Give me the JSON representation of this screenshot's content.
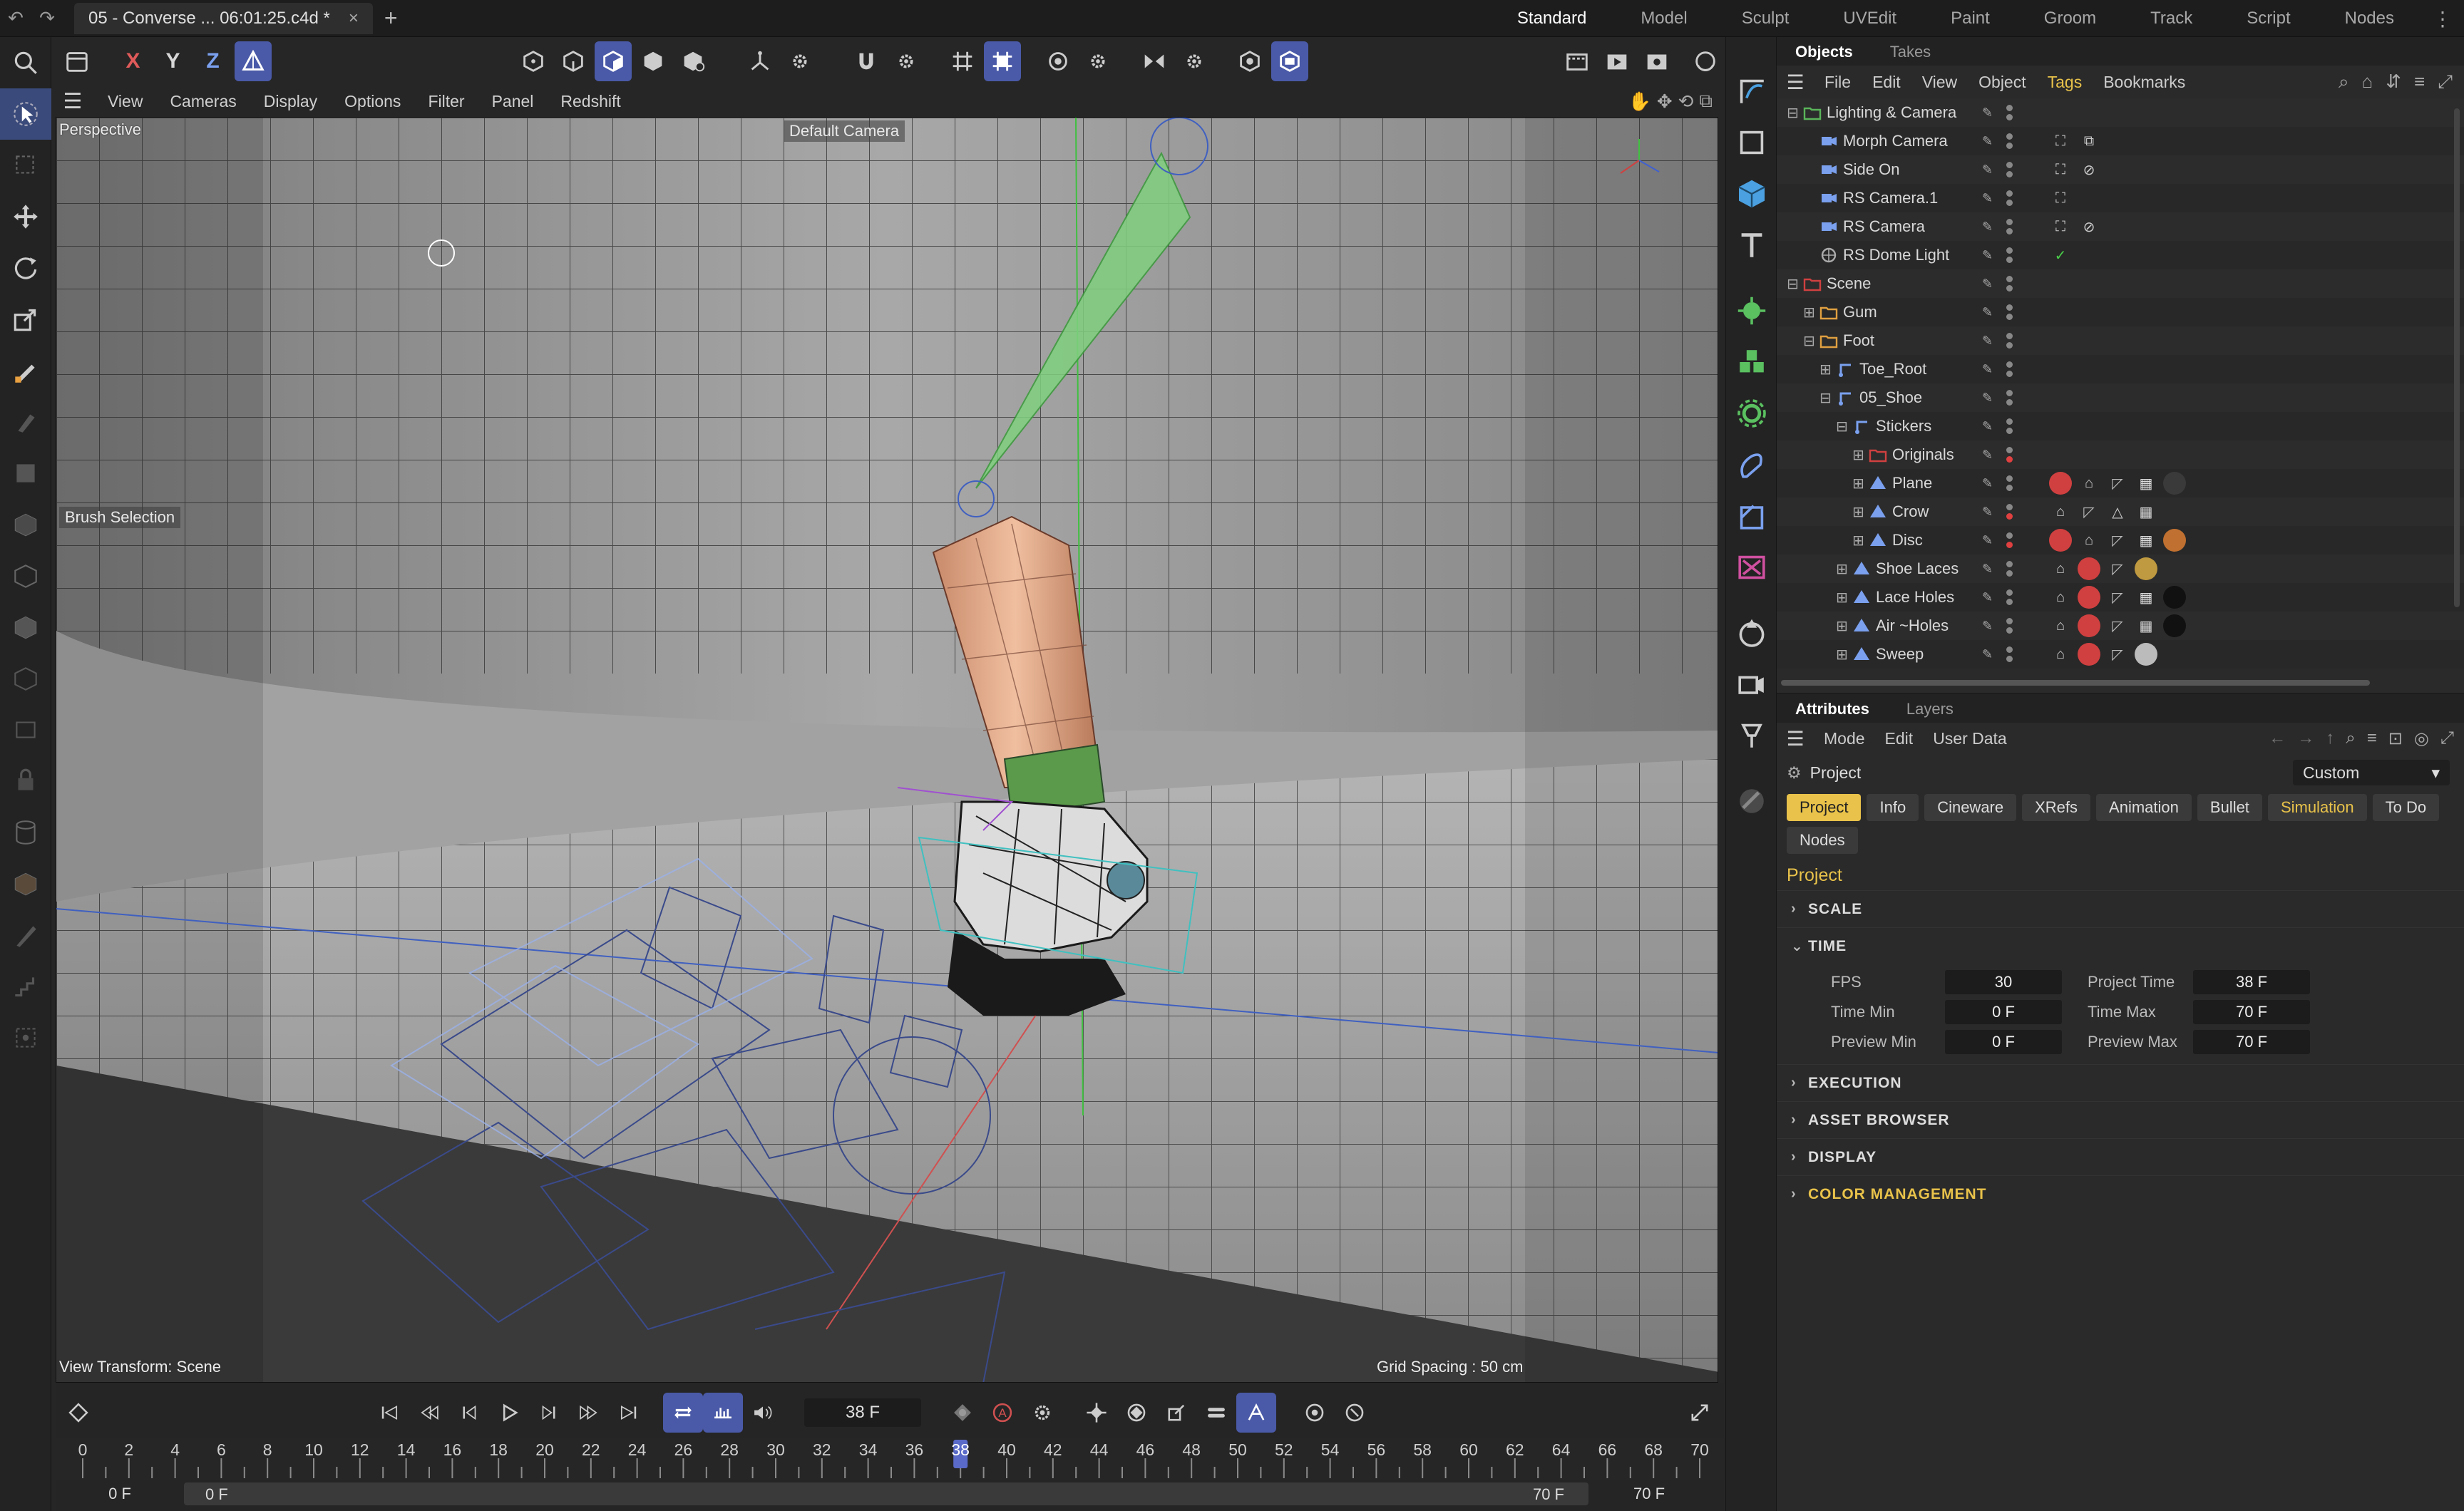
{
  "titlebar": {
    "doc_title": "05 - Converse ... 06:01:25.c4d *",
    "close": "×",
    "new_tab": "+",
    "layouts": [
      "Standard",
      "Model",
      "Sculpt",
      "UVEdit",
      "Paint",
      "Groom",
      "Track",
      "Script",
      "Nodes"
    ],
    "menu": "⋮"
  },
  "toolbar": {
    "x": "X",
    "y": "Y",
    "z": "Z"
  },
  "viewport_menu": [
    "View",
    "Cameras",
    "Display",
    "Options",
    "Filter",
    "Panel",
    "Redshift"
  ],
  "viewport": {
    "view_name": "Perspective",
    "camera_name": "Default Camera",
    "brush_label": "Brush Selection",
    "view_transform": "View Transform: Scene",
    "grid_spacing": "Grid Spacing : 50 cm"
  },
  "timeline": {
    "current_frame": "38 F",
    "ticks": [
      "0",
      "2",
      "4",
      "6",
      "8",
      "10",
      "12",
      "14",
      "16",
      "18",
      "20",
      "22",
      "24",
      "26",
      "28",
      "30",
      "32",
      "34",
      "36",
      "38",
      "40",
      "42",
      "44",
      "46",
      "48",
      "50",
      "52",
      "54",
      "56",
      "58",
      "60",
      "62",
      "64",
      "66",
      "68",
      "70"
    ],
    "playhead_value": 38,
    "range_start_outer": "0 F",
    "range_start_inner": "0 F",
    "range_end_inner": "70 F",
    "range_end_outer": "70 F"
  },
  "panel_tabs": [
    "Objects",
    "Takes"
  ],
  "objects_menu": [
    "File",
    "Edit",
    "View",
    "Object",
    "Tags",
    "Bookmarks"
  ],
  "objects": [
    {
      "name": "Lighting & Camera",
      "depth": 0,
      "expanded": "-",
      "icon": "null",
      "color": "#5ab45a"
    },
    {
      "name": "Morph Camera",
      "depth": 1,
      "expanded": "",
      "icon": "camera",
      "color": "#7aa0ee"
    },
    {
      "name": "Side On",
      "depth": 1,
      "expanded": "",
      "icon": "camera",
      "color": "#7aa0ee"
    },
    {
      "name": "RS Camera.1",
      "depth": 1,
      "expanded": "",
      "icon": "camera",
      "color": "#7aa0ee"
    },
    {
      "name": "RS Camera",
      "depth": 1,
      "expanded": "",
      "icon": "camera",
      "color": "#7aa0ee"
    },
    {
      "name": "RS Dome Light",
      "depth": 1,
      "expanded": "",
      "icon": "light",
      "color": "#aaaaaa"
    },
    {
      "name": "Scene",
      "depth": 0,
      "expanded": "-",
      "icon": "null",
      "color": "#d04040"
    },
    {
      "name": "Gum",
      "depth": 1,
      "expanded": "+",
      "icon": "null",
      "color": "#e0a040"
    },
    {
      "name": "Foot",
      "depth": 1,
      "expanded": "-",
      "icon": "null",
      "color": "#e0a040"
    },
    {
      "name": "Toe_Root",
      "depth": 2,
      "expanded": "+",
      "icon": "joint",
      "color": "#7aa0ee"
    },
    {
      "name": "05_Shoe",
      "depth": 2,
      "expanded": "-",
      "icon": "joint",
      "color": "#7aa0ee"
    },
    {
      "name": "Stickers",
      "depth": 3,
      "expanded": "-",
      "icon": "joint",
      "color": "#7aa0ee"
    },
    {
      "name": "Originals",
      "depth": 4,
      "expanded": "+",
      "icon": "null",
      "color": "#d04040"
    },
    {
      "name": "Plane",
      "depth": 4,
      "expanded": "+",
      "icon": "poly",
      "color": "#7aa0ee"
    },
    {
      "name": "Crow",
      "depth": 4,
      "expanded": "+",
      "icon": "poly",
      "color": "#7aa0ee"
    },
    {
      "name": "Disc",
      "depth": 4,
      "expanded": "+",
      "icon": "poly",
      "color": "#7aa0ee"
    },
    {
      "name": "Shoe Laces",
      "depth": 3,
      "expanded": "+",
      "icon": "poly",
      "color": "#7aa0ee"
    },
    {
      "name": "Lace Holes",
      "depth": 3,
      "expanded": "+",
      "icon": "poly",
      "color": "#7aa0ee"
    },
    {
      "name": "Air ~Holes",
      "depth": 3,
      "expanded": "+",
      "icon": "poly",
      "color": "#7aa0ee"
    },
    {
      "name": "Sweep",
      "depth": 3,
      "expanded": "+",
      "icon": "poly",
      "color": "#7aa0ee"
    }
  ],
  "attributes": {
    "tabs": [
      "Attributes",
      "Layers"
    ],
    "menu": [
      "Mode",
      "Edit",
      "User Data"
    ],
    "header_label": "Project",
    "preset": "Custom",
    "pills": [
      "Project",
      "Info",
      "Cineware",
      "XRefs",
      "Animation",
      "Bullet",
      "Simulation",
      "To Do",
      "Nodes"
    ],
    "section_title": "Project",
    "groups": {
      "scale": "SCALE",
      "time": "TIME",
      "execution": "EXECUTION",
      "asset_browser": "ASSET BROWSER",
      "display": "DISPLAY",
      "color_management": "COLOR MANAGEMENT"
    },
    "time": {
      "fps_label": "FPS",
      "fps": "30",
      "project_time_label": "Project Time",
      "project_time": "38 F",
      "time_min_label": "Time Min",
      "time_min": "0 F",
      "time_max_label": "Time Max",
      "time_max": "70 F",
      "preview_min_label": "Preview Min",
      "preview_min": "0 F",
      "preview_max_label": "Preview Max",
      "preview_max": "70 F"
    }
  },
  "colors": {
    "accent_blue": "#4a5aa8",
    "accent_yellow": "#e8c24a"
  }
}
